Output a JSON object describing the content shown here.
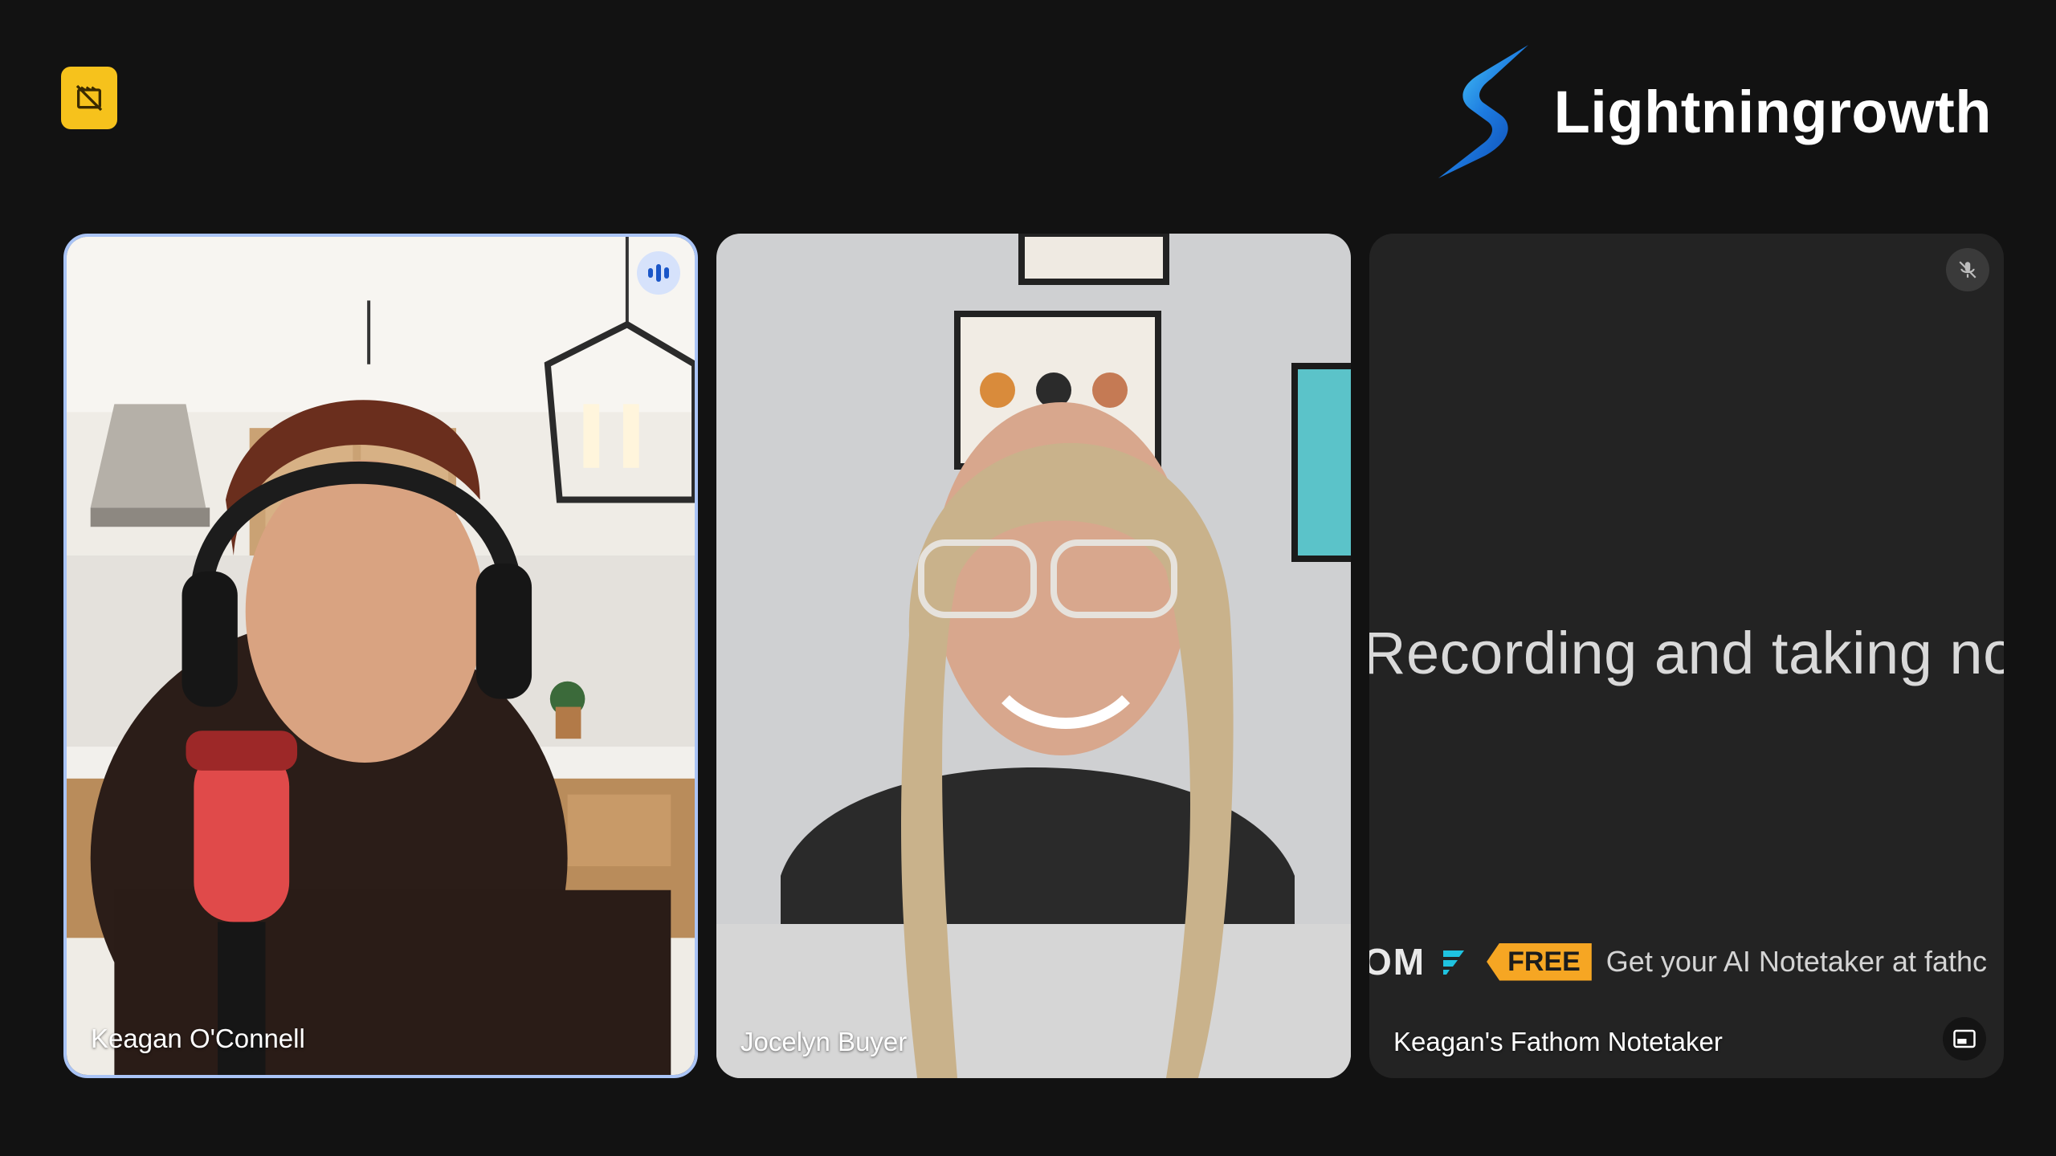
{
  "brand": {
    "name": "Lightningrowth"
  },
  "participants": [
    {
      "name": "Keagan O'Connell",
      "speaking": true
    },
    {
      "name": "Jocelyn Buyer",
      "speaking": false
    },
    {
      "name": "Keagan's Fathom Notetaker",
      "muted": true
    }
  ],
  "notetaker": {
    "status_text": "Recording and taking notes",
    "promo_brand": "OM",
    "promo_badge": "FREE",
    "promo_text": "Get your AI Notetaker at fathc"
  },
  "icons": {
    "recording_badge": "no-video-icon",
    "speaking": "audio-bars-icon",
    "muted": "mic-off-icon",
    "pip": "picture-in-picture-icon"
  },
  "colors": {
    "background": "#121212",
    "badge_yellow": "#f6c21c",
    "active_border": "#aac4f6",
    "promo_orange": "#f6a623"
  }
}
